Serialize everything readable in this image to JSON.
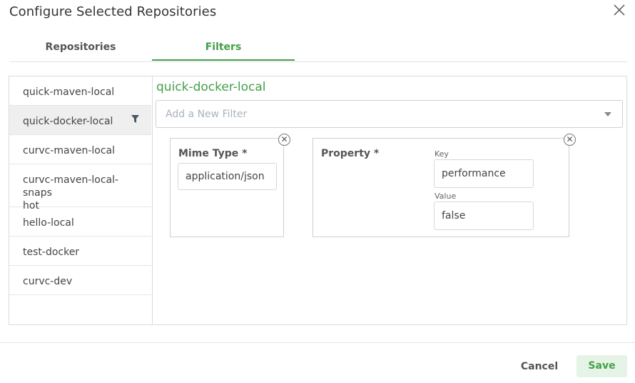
{
  "dialog": {
    "title": "Configure Selected Repositories",
    "close_icon": "close-icon"
  },
  "tabs": [
    {
      "label": "Repositories",
      "active": false
    },
    {
      "label": "Filters",
      "active": true
    }
  ],
  "repositories": [
    {
      "name": "quick-maven-local",
      "active": false
    },
    {
      "name": "quick-docker-local",
      "active": true,
      "icon": "filter-icon"
    },
    {
      "name": "curvc-maven-local",
      "active": false
    },
    {
      "name": "curvc-maven-local-snaps\nhot",
      "active": false
    },
    {
      "name": "hello-local",
      "active": false
    },
    {
      "name": "test-docker",
      "active": false
    },
    {
      "name": "curvc-dev",
      "active": false
    }
  ],
  "detail": {
    "repo_title": "quick-docker-local",
    "filter_placeholder": "Add a New Filter",
    "filters": {
      "mime": {
        "label": "Mime Type *",
        "value": "application/json"
      },
      "property": {
        "label": "Property *",
        "key_label": "Key",
        "key_value": "performance",
        "value_label": "Value",
        "value_value": "false"
      }
    }
  },
  "footer": {
    "cancel_label": "Cancel",
    "save_label": "Save"
  },
  "colors": {
    "accent": "#43a047",
    "save_bg": "#e6f4e8"
  }
}
